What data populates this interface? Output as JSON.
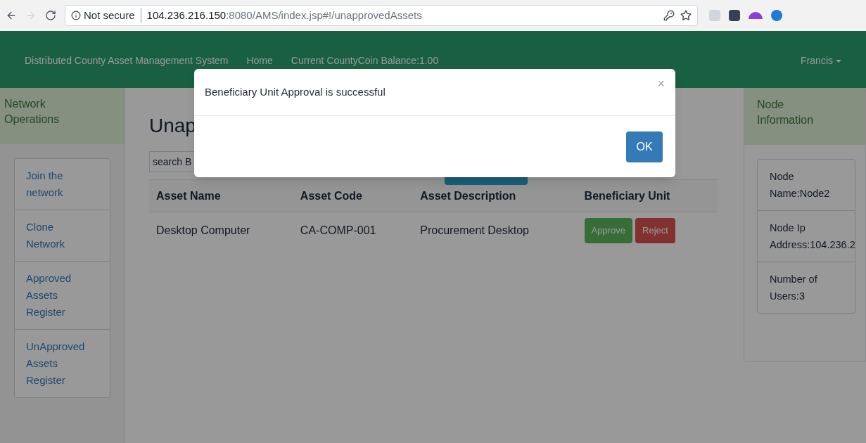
{
  "browser": {
    "security": "Not secure",
    "url_host": "104.236.216.150",
    "url_rest": ":8080/AMS/index.jsp#!/unapprovedAssets"
  },
  "navbar": {
    "brand": "Distributed County Asset Management System",
    "links": [
      "Home",
      "Current CountyCoin Balance:1.00"
    ],
    "user": "Francis"
  },
  "left_panel": {
    "title": "Network Operations",
    "items": [
      {
        "label": "Join the network"
      },
      {
        "label": "Clone Network"
      },
      {
        "label": "Approved Assets Register"
      },
      {
        "label": "UnApproved Assets Register"
      }
    ]
  },
  "main": {
    "title": "Unap",
    "search": {
      "placeholder": "search B"
    },
    "table": {
      "columns": [
        "Asset Name",
        "Asset Code",
        "Asset Description",
        "Beneficiary Unit"
      ],
      "rows": [
        {
          "cells": [
            "Desktop Computer",
            "CA-COMP-001",
            "Procurement Desktop"
          ],
          "actions": [
            {
              "label": "Approve",
              "kind": "approve"
            },
            {
              "label": "Reject",
              "kind": "reject"
            }
          ]
        }
      ]
    }
  },
  "right_panel": {
    "title": "Node Information",
    "items": [
      "Node Name:Node2",
      "Node Ip Address:104.236.2",
      "Number of Users:3"
    ]
  },
  "modal": {
    "message": "Beneficiary Unit Approval is successful",
    "close": "×",
    "button": "OK"
  }
}
